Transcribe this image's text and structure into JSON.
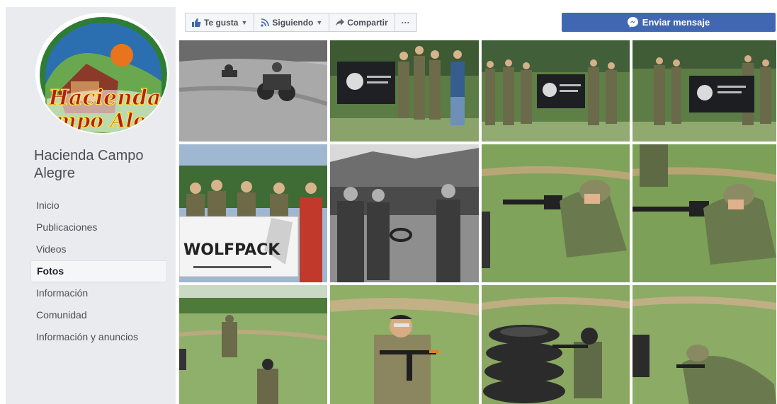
{
  "page": {
    "name": "Hacienda Campo Alegre",
    "logo_text": "Hacienda Campo Alegre"
  },
  "sidebar": {
    "items": [
      {
        "label": "Inicio",
        "active": false
      },
      {
        "label": "Publicaciones",
        "active": false
      },
      {
        "label": "Videos",
        "active": false
      },
      {
        "label": "Fotos",
        "active": true
      },
      {
        "label": "Información",
        "active": false
      },
      {
        "label": "Comunidad",
        "active": false
      },
      {
        "label": "Información y anuncios",
        "active": false
      }
    ]
  },
  "toolbar": {
    "like_label": "Te gusta",
    "follow_label": "Siguiendo",
    "share_label": "Compartir",
    "more_label": "···",
    "message_label": "Enviar mensaje"
  },
  "photos": {
    "count": 12,
    "tiles": [
      {
        "subject": "motorcycles",
        "tone": "bw"
      },
      {
        "subject": "group-flag",
        "tone": "color"
      },
      {
        "subject": "group-flag",
        "tone": "color"
      },
      {
        "subject": "group-flag",
        "tone": "color"
      },
      {
        "subject": "wolfpack-banner",
        "tone": "color",
        "banner_text": "WOLFPACK"
      },
      {
        "subject": "soldiers-walking",
        "tone": "bw"
      },
      {
        "subject": "kneeling-rifle",
        "tone": "color"
      },
      {
        "subject": "kneeling-rifle",
        "tone": "color"
      },
      {
        "subject": "field-advance",
        "tone": "color"
      },
      {
        "subject": "player-rifle",
        "tone": "color"
      },
      {
        "subject": "tires-cover",
        "tone": "color"
      },
      {
        "subject": "prone-shooter",
        "tone": "color"
      }
    ]
  },
  "colors": {
    "brand_blue": "#4267b2",
    "sidebar_bg": "#e9ebee",
    "grass": "#7fa35a"
  }
}
